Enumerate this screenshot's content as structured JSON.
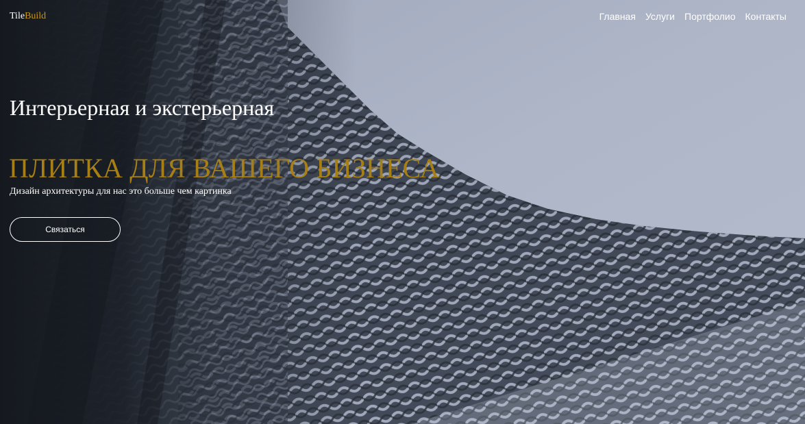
{
  "logo": {
    "part1": "Tile",
    "part2": "Build"
  },
  "nav": {
    "items": [
      "Главная",
      "Услуги",
      "Портфолио",
      "Контакты"
    ]
  },
  "hero": {
    "headline": "Интерьерная и экстерьерная",
    "accent_title": "ПЛИТКА ДЛЯ ВАШЕГО БИЗНЕСА",
    "subtitle": "Дизайн архитектуры для нас это больше чем картинка",
    "cta_label": "Связаться"
  },
  "colors": {
    "accent": "#a87f14",
    "text": "#ffffff",
    "sky": "#a9b1c3",
    "dark_bg": "#1a1e24"
  },
  "background": {
    "description_icon": "architecture-facade-image"
  }
}
